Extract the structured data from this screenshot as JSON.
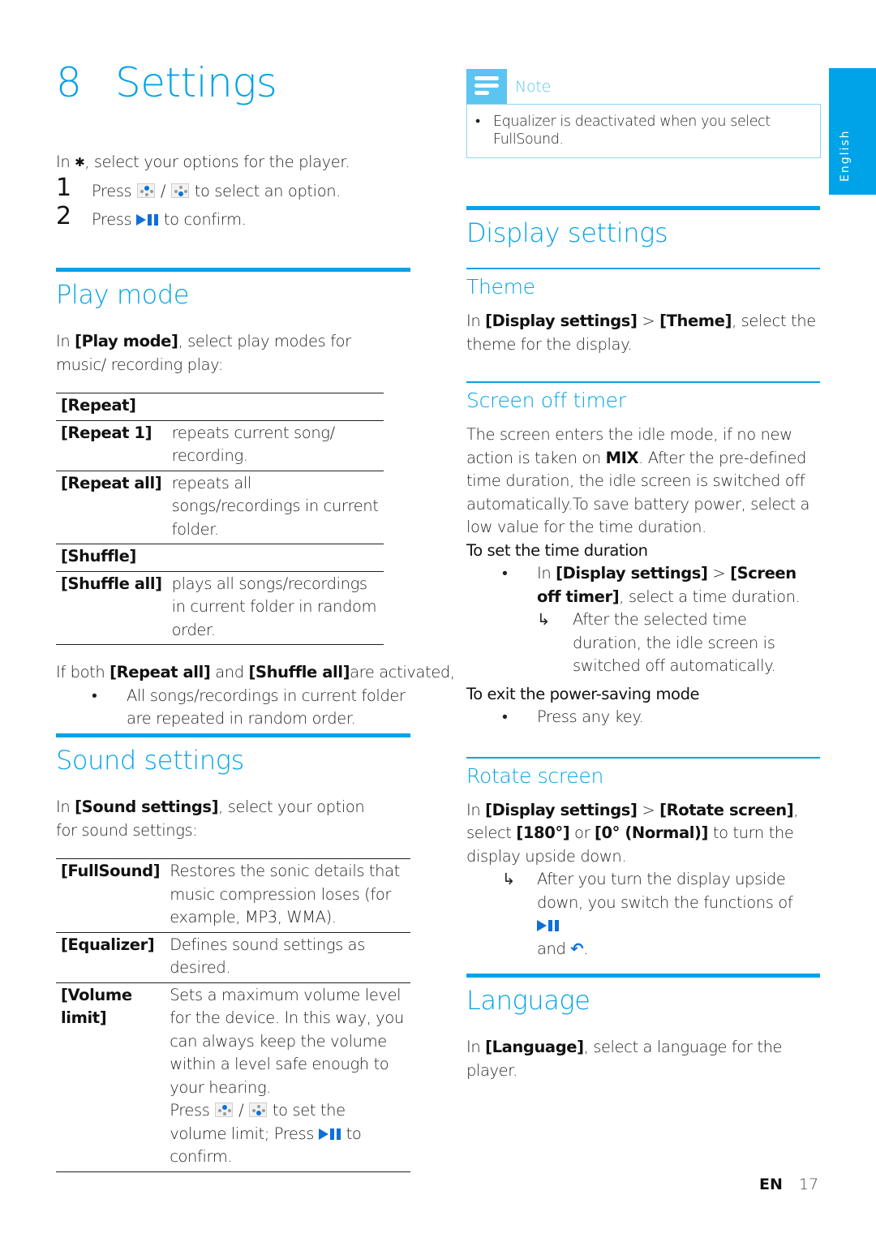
{
  "chapter": {
    "number": "8",
    "title": "Settings"
  },
  "intro": {
    "prefix": "In ",
    "gear_icon": "gear-icon",
    "suffix": ", select your options for the player.",
    "steps": [
      {
        "n": "1",
        "pre": "Press ",
        "sep": " / ",
        "post": " to select an option."
      },
      {
        "n": "2",
        "pre": "Press ",
        "post": " to confirm."
      }
    ]
  },
  "play_mode": {
    "title": "Play mode",
    "desc_pre": "In ",
    "desc_bold": "[Play mode]",
    "desc_post": ", select play modes for music/ recording play:",
    "rows": [
      {
        "key": "[Repeat]",
        "value": ""
      },
      {
        "key": "[Repeat 1]",
        "value": "repeats current song/ recording."
      },
      {
        "key": "[Repeat all]",
        "value": "repeats all songs/recordings in current folder."
      },
      {
        "key": "[Shuffle]",
        "value": ""
      },
      {
        "key": "[Shuffle all]",
        "value": "plays all songs/recordings in current folder in random order."
      }
    ],
    "after_pre": "If both ",
    "after_b1": "[Repeat all]",
    "after_mid": " and ",
    "after_b2": "[Shuffle all]",
    "after_post": "are activated,",
    "bullet": "All songs/recordings in current folder are repeated in random order."
  },
  "sound_settings": {
    "title": "Sound settings",
    "desc_pre": " In ",
    "desc_bold": "[Sound settings]",
    "desc_post": ", select your option for sound settings:",
    "rows": [
      {
        "key": "[FullSound]",
        "value": "Restores the sonic details that music compression loses (for example, MP3, WMA)."
      },
      {
        "key": "[Equalizer]",
        "value": "Defines sound settings as desired."
      },
      {
        "key": "[Volume limit]",
        "value": "Sets a maximum volume level for the device. In this way, you can always keep the volume within a level safe enough to your hearing."
      }
    ],
    "volume_press_pre": "Press ",
    "volume_press_sep": " / ",
    "volume_press_mid": " to set the volume limit; Press ",
    "volume_press_post": " to confirm."
  },
  "note": {
    "label": "Note",
    "text": "Equalizer is deactivated when you select FullSound."
  },
  "side_tab": {
    "label": "English"
  },
  "display_settings": {
    "title": "Display settings",
    "theme": {
      "title": "Theme",
      "pre": "In ",
      "b1": "[Display settings]",
      "sep": " > ",
      "b2": "[Theme]",
      "post": ", select the theme for the display."
    },
    "screen_off": {
      "title": "Screen off timer",
      "para_pre": "The screen enters the idle mode, if no new action is taken on ",
      "para_bold": "MIX",
      "para_post": ". After the pre-defined time duration, the idle screen is switched off automatically.To save battery power, select a low value for the time duration.",
      "set_heading": "To set the time duration",
      "set_pre": "In ",
      "set_b1": "[Display settings]",
      "set_sep": " > ",
      "set_b2": "[Screen off timer]",
      "set_post": ", select a time duration.",
      "set_result": "After the selected time duration, the idle screen is switched off automatically.",
      "exit_heading": "To exit the power-saving mode",
      "exit_bullet": "Press any key."
    },
    "rotate": {
      "title": "Rotate screen",
      "pre": "In ",
      "b1": "[Display settings]",
      "sep": " > ",
      "b2": "[Rotate screen]",
      "mid": ", select ",
      "b3": "[180°]",
      "or": " or ",
      "b4": "[0° (Normal)]",
      "post": " to turn the display upside down.",
      "result_pre": "After you turn the display upside down, you switch the functions of ",
      "result_and": " and ",
      "result_end": "."
    }
  },
  "language": {
    "title": "Language",
    "pre": "In ",
    "bold": "[Language]",
    "post": ", select a language for the player."
  },
  "footer": {
    "lang": "EN",
    "page": "17"
  },
  "bullet_char": "•",
  "arrow_char": "↳"
}
